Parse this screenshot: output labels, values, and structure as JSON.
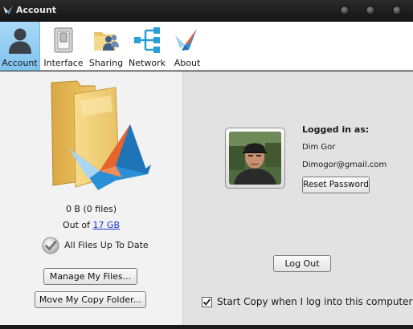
{
  "window": {
    "title": "Account"
  },
  "tabs": [
    {
      "label": "Account",
      "icon": "user-icon",
      "active": true
    },
    {
      "label": "Interface",
      "icon": "toggle-switch-icon",
      "active": false
    },
    {
      "label": "Sharing",
      "icon": "shared-folder-icon",
      "active": false
    },
    {
      "label": "Network",
      "icon": "network-icon",
      "active": false
    },
    {
      "label": "About",
      "icon": "copy-crane-icon",
      "active": false
    }
  ],
  "storage": {
    "used": "0 B (0 files)",
    "quota_prefix": "Out of ",
    "quota_link": "17 GB",
    "sync_status": "All Files Up To Date"
  },
  "buttons": {
    "manage_files": "Manage My Files...",
    "move_folder": "Move My Copy Folder...",
    "reset_password": "Reset Password",
    "log_out": "Log Out"
  },
  "account": {
    "logged_in_label": "Logged in as:",
    "name": "Dim Gor",
    "email": "Dimogor@gmail.com"
  },
  "startup": {
    "label": "Start Copy when I log into this computer",
    "checked": true
  },
  "colors": {
    "active_tab": "#8ecbf1",
    "link": "#1b36c9",
    "brand_orange": "#e8622a",
    "brand_blue": "#2a8fd6"
  }
}
